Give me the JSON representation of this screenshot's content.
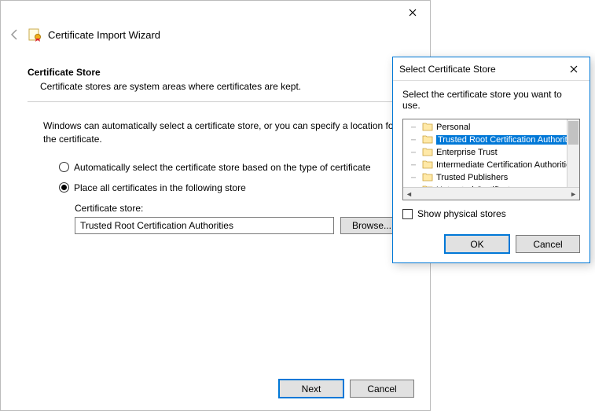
{
  "wizard": {
    "title": "Certificate Import Wizard",
    "section_head": "Certificate Store",
    "section_sub": "Certificate stores are system areas where certificates are kept.",
    "desc": "Windows can automatically select a certificate store, or you can specify a location for the certificate.",
    "radio_auto": "Automatically select the certificate store based on the type of certificate",
    "radio_place": "Place all certificates in the following store",
    "store_label": "Certificate store:",
    "store_value": "Trusted Root Certification Authorities",
    "browse": "Browse...",
    "next": "Next",
    "cancel": "Cancel"
  },
  "dlg": {
    "title": "Select Certificate Store",
    "instr": "Select the certificate store you want to use.",
    "items": [
      "Personal",
      "Trusted Root Certification Authorities",
      "Enterprise Trust",
      "Intermediate Certification Authorities",
      "Trusted Publishers",
      "Untrusted Certificates"
    ],
    "selected_index": 1,
    "show_physical": "Show physical stores",
    "ok": "OK",
    "cancel": "Cancel"
  }
}
